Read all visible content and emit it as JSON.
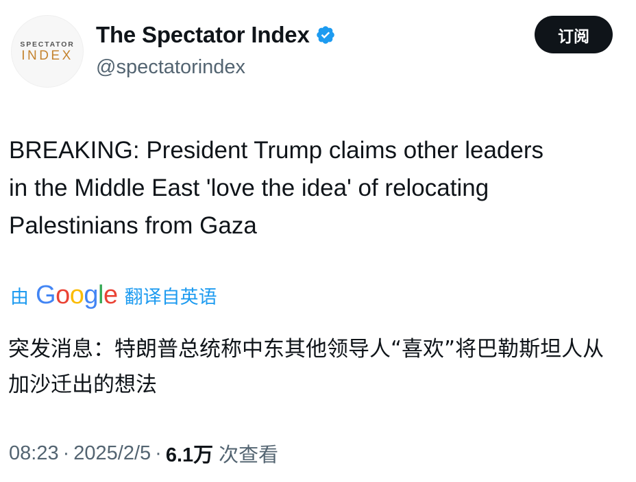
{
  "author": {
    "display_name": "The Spectator Index",
    "handle": "@spectatorindex",
    "logo_top": "SPECTATOR",
    "logo_bottom": "INDEX",
    "verified_color": "#1d9bf0"
  },
  "actions": {
    "subscribe_label": "订阅"
  },
  "tweet": {
    "text": "BREAKING: President Trump claims other leaders in the Middle East 'love the idea' of relocating Palestinians from Gaza"
  },
  "translation": {
    "by_label": "由",
    "provider_letters": [
      "G",
      "o",
      "o",
      "g",
      "l",
      "e"
    ],
    "from_label": "翻译自英语",
    "text": "突发消息：特朗普总统称中东其他领导人“喜欢”将巴勒斯坦人从加沙迁出的想法"
  },
  "meta": {
    "time": "08:23",
    "separator": "·",
    "date": "2025/2/5",
    "views_count": "6.1万",
    "views_label": "次查看"
  },
  "colors": {
    "text_primary": "#0f1419",
    "text_secondary": "#536471",
    "link": "#1d9bf0",
    "button_bg": "#0f1419"
  }
}
